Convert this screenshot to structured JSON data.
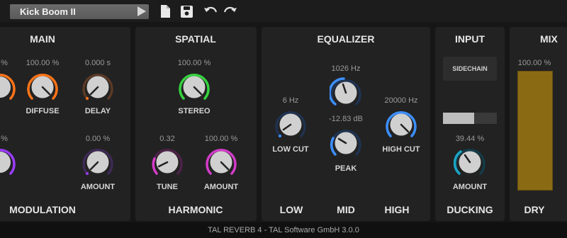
{
  "preset": {
    "name": "Kick Boom II"
  },
  "icons": {
    "play": "play-icon",
    "file": "file-icon",
    "save": "save-icon",
    "undo": "undo-icon",
    "redo": "redo-icon"
  },
  "colors": {
    "orange": "#ff7418",
    "purple": "#9b3cff",
    "green": "#35d43f",
    "magenta": "#d23cc8",
    "blue": "#3d8fff",
    "teal": "#1aa6c6",
    "dry": "#8a6b14"
  },
  "main": {
    "title": "MAIN",
    "bottom_label": "MODULATION",
    "knobs": [
      {
        "value": "100.00 %",
        "label": "DIFFUSE"
      },
      {
        "value": "0.000 s",
        "label": "DELAY"
      },
      {
        "value": "0.00 %",
        "label": "AMOUNT"
      }
    ],
    "partial_values": [
      "%",
      "%"
    ]
  },
  "spatial": {
    "title": "SPATIAL",
    "bottom_label": "HARMONIC",
    "knobs": [
      {
        "value": "100.00 %",
        "label": "STEREO"
      },
      {
        "value": "0.32",
        "label": "TUNE"
      },
      {
        "value": "100.00 %",
        "label": "AMOUNT"
      }
    ]
  },
  "equalizer": {
    "title": "EQUALIZER",
    "bands": [
      "LOW",
      "MID",
      "HIGH"
    ],
    "knobs": [
      {
        "value": "6 Hz",
        "label": "LOW CUT"
      },
      {
        "value": "1026 Hz",
        "label": ""
      },
      {
        "value": "-12.83 dB",
        "label": "PEAK"
      },
      {
        "value": "20000 Hz",
        "label": "HIGH CUT"
      }
    ]
  },
  "input": {
    "title": "INPUT",
    "bottom_label": "DUCKING",
    "sidechain_label": "SIDECHAIN",
    "meter_level": 0.58,
    "knobs": [
      {
        "value": "39.44 %",
        "label": "AMOUNT"
      }
    ]
  },
  "mix": {
    "title": "MIX",
    "bottom_label": "DRY",
    "value": "100.00 %",
    "level": 1.0
  },
  "footer": {
    "text": "TAL REVERB 4 - TAL Software GmbH 3.0.0"
  }
}
